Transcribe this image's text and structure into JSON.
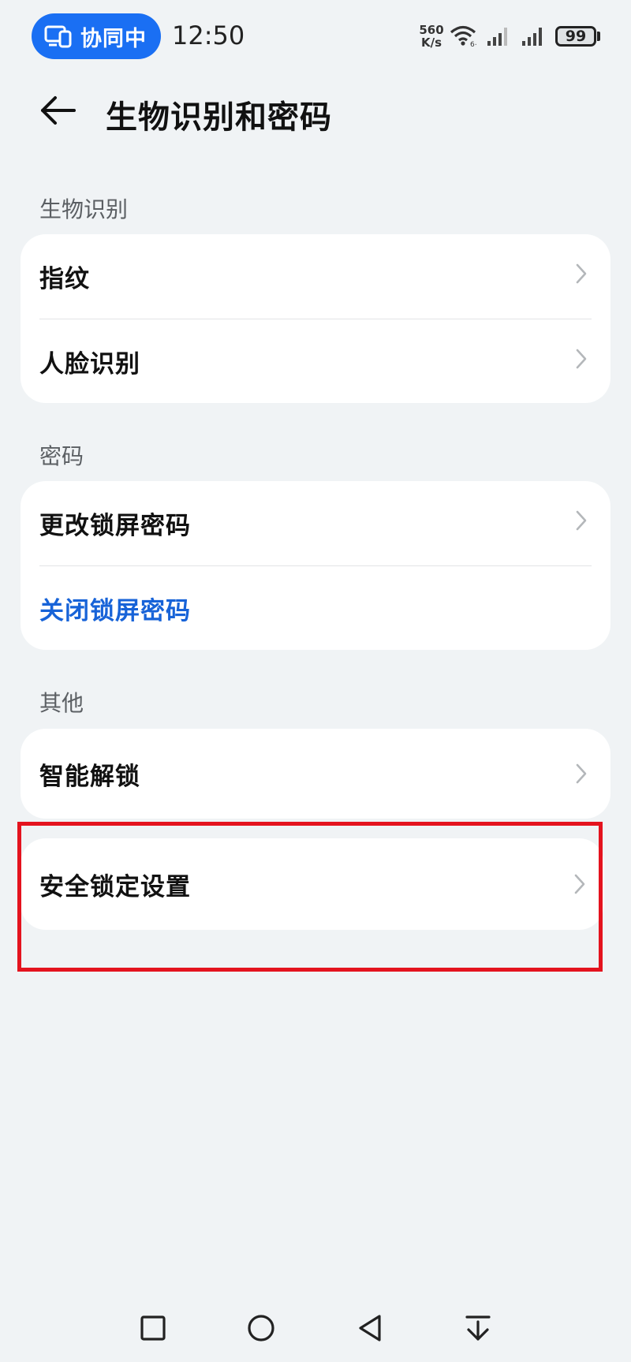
{
  "status_bar": {
    "collab_label": "协同中",
    "time": "12:50",
    "net_speed_value": "560",
    "net_speed_unit": "K/s",
    "battery": "99"
  },
  "header": {
    "title": "生物识别和密码"
  },
  "sections": {
    "biometrics": {
      "label": "生物识别",
      "items": [
        "指纹",
        "人脸识别"
      ]
    },
    "password": {
      "label": "密码",
      "items": [
        "更改锁屏密码",
        "关闭锁屏密码"
      ]
    },
    "other": {
      "label": "其他",
      "items": [
        "智能解锁",
        "安全锁定设置"
      ]
    }
  },
  "colors": {
    "accent": "#1a6ff3",
    "link_blue": "#1763d8",
    "highlight_red": "#e4131e",
    "background": "#f0f3f5"
  },
  "nav_bar": {
    "icons": [
      "recent-apps-icon",
      "home-icon",
      "back-icon",
      "notification-pull-icon"
    ]
  }
}
